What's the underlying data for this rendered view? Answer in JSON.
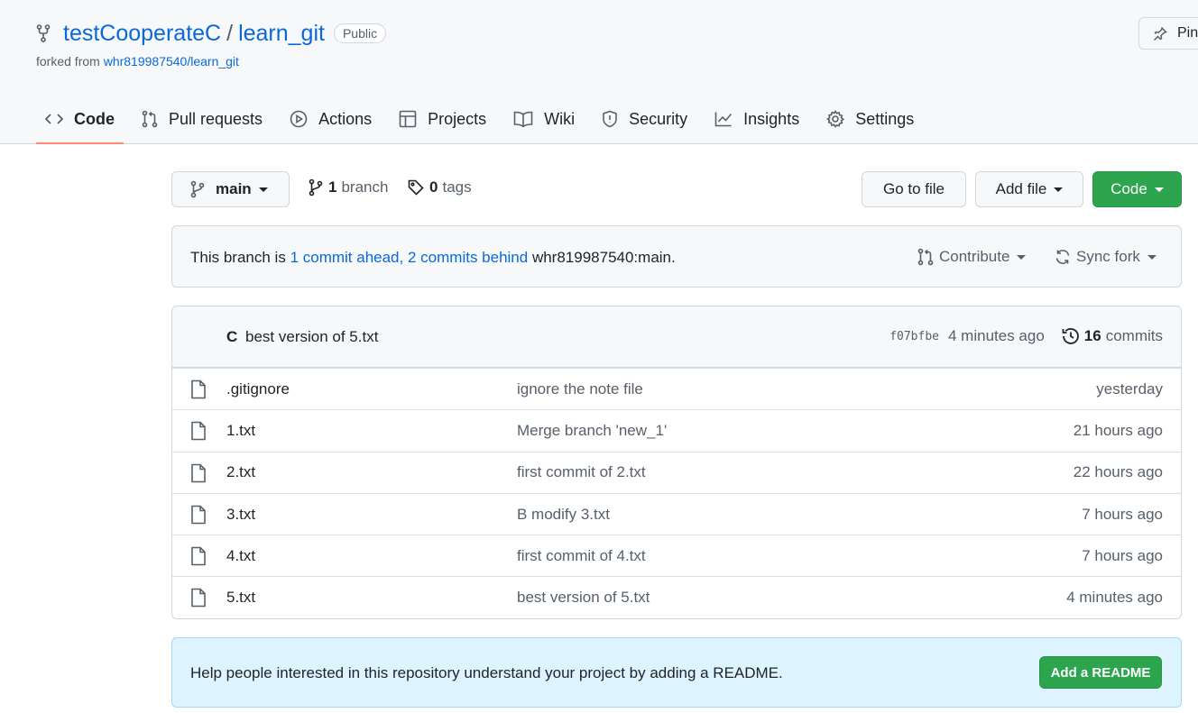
{
  "repo": {
    "owner": "testCooperateC",
    "separator": "/",
    "name": "learn_git",
    "visibility": "Public",
    "forked_prefix": "forked from",
    "forked_source": "whr819987540/learn_git",
    "pin_label": "Pin"
  },
  "tabs": [
    {
      "label": "Code",
      "icon": "code-icon",
      "selected": true
    },
    {
      "label": "Pull requests",
      "icon": "git-pull-request-icon"
    },
    {
      "label": "Actions",
      "icon": "play-icon"
    },
    {
      "label": "Projects",
      "icon": "table-icon"
    },
    {
      "label": "Wiki",
      "icon": "book-icon"
    },
    {
      "label": "Security",
      "icon": "shield-icon"
    },
    {
      "label": "Insights",
      "icon": "graph-icon"
    },
    {
      "label": "Settings",
      "icon": "gear-icon"
    }
  ],
  "toolbar": {
    "branch": "main",
    "branch_count": "1",
    "branch_word": "branch",
    "tag_count": "0",
    "tag_word": "tags",
    "go_to_file": "Go to file",
    "add_file": "Add file",
    "code": "Code"
  },
  "fork_status": {
    "prefix": "This branch is",
    "ahead": "1 commit ahead,",
    "behind": "2 commits behind",
    "suffix": "whr819987540:main.",
    "contribute": "Contribute",
    "sync": "Sync fork"
  },
  "latest_commit": {
    "author": "C",
    "message": "best version of 5.txt",
    "sha": "f07bfbe",
    "time": "4 minutes ago",
    "commit_count": "16",
    "commit_word": "commits"
  },
  "files": [
    {
      "name": ".gitignore",
      "message": "ignore the note file",
      "age": "yesterday"
    },
    {
      "name": "1.txt",
      "message": "Merge branch 'new_1'",
      "age": "21 hours ago"
    },
    {
      "name": "2.txt",
      "message": "first commit of 2.txt",
      "age": "22 hours ago"
    },
    {
      "name": "3.txt",
      "message": "B modify 3.txt",
      "age": "7 hours ago"
    },
    {
      "name": "4.txt",
      "message": "first commit of 4.txt",
      "age": "7 hours ago"
    },
    {
      "name": "5.txt",
      "message": "best version of 5.txt",
      "age": "4 minutes ago"
    }
  ],
  "readme": {
    "message": "Help people interested in this repository understand your project by adding a README.",
    "button": "Add a README"
  },
  "colors": {
    "accent_link": "#0969da",
    "primary_button": "#2da44e",
    "tab_underline": "#fd8c73",
    "readme_bg": "#ddf4ff"
  }
}
